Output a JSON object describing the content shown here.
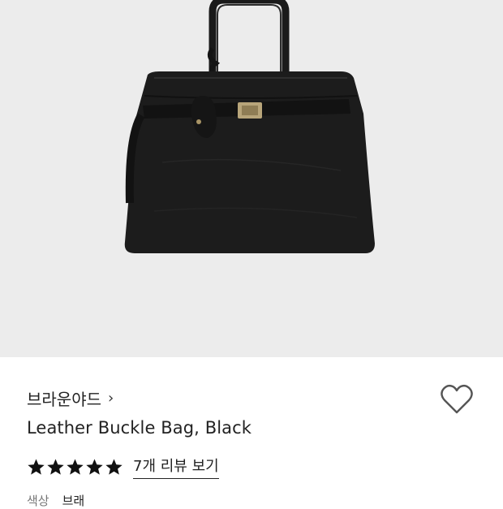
{
  "product": {
    "image_name": "black-leather-buckle-bag",
    "brand": "브라운야드",
    "brand_chevron": "›",
    "title": "Leather Buckle Bag, Black",
    "rating_stars": 5,
    "review_link": "7개 리뷰 보기",
    "option_label": "색상",
    "option_value": "브래"
  },
  "icons": {
    "wishlist": "heart-outline-icon",
    "star": "star-filled-icon",
    "brand_chevron": "chevron-right-icon"
  },
  "colors": {
    "hero_bg": "#ececec",
    "star": "#111111",
    "bag": "#1c1c1c"
  }
}
